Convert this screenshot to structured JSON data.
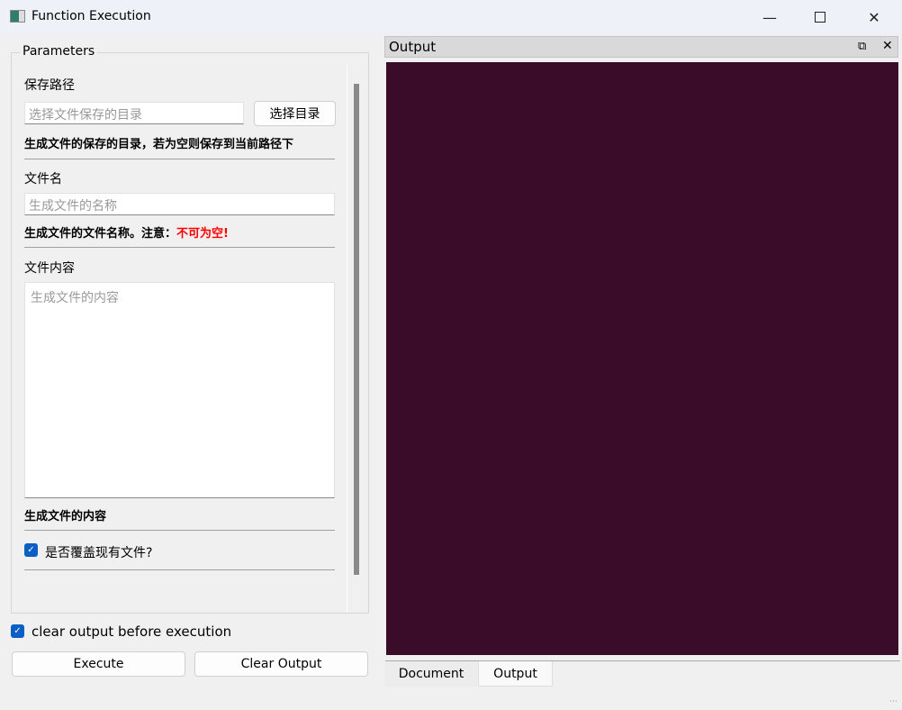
{
  "window": {
    "title": "Function Execution",
    "icons": [
      "app-icon",
      "minimize-icon",
      "maximize-icon",
      "close-icon"
    ]
  },
  "params": {
    "group_title": "Parameters",
    "save_path": {
      "label": "保存路径",
      "placeholder": "选择文件保存的目录",
      "button": "选择目录",
      "desc": "生成文件的保存的目录，若为空则保存到当前路径下"
    },
    "file_name": {
      "label": "文件名",
      "placeholder": "生成文件的名称",
      "desc": "生成文件的文件名称。注意：",
      "desc_warn": "不可为空!"
    },
    "content": {
      "label": "文件内容",
      "placeholder": "生成文件的内容",
      "desc": "生成文件的内容"
    },
    "overwrite": {
      "label": "是否覆盖现有文件?",
      "checked": true
    }
  },
  "clear_before": {
    "label": "clear output before execution",
    "checked": true
  },
  "buttons": {
    "execute": "Execute",
    "clear": "Clear Output"
  },
  "dock": {
    "title": "Output",
    "background": "#3b0c2a"
  },
  "tabs": [
    {
      "label": "Document",
      "active": false
    },
    {
      "label": "Output",
      "active": true
    }
  ]
}
